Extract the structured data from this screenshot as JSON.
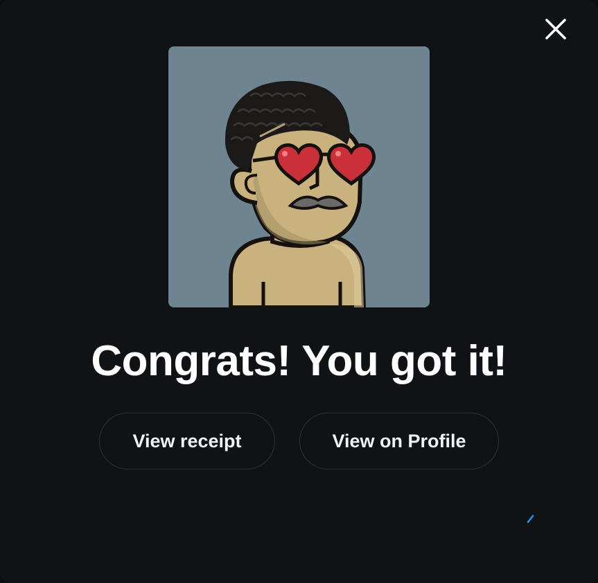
{
  "dialog": {
    "headline": "Congrats! You got it!",
    "close_icon": "close-icon",
    "nft_image": "cartoon-avatar-heart-sunglasses-mustache",
    "buttons": {
      "view_receipt": "View receipt",
      "view_on_profile": "View on Profile"
    }
  },
  "colors": {
    "background": "#111215",
    "button_border": "#2f3237",
    "text": "#ffffff",
    "art_background": "#6e8591",
    "skin": "#c9b27e",
    "heart": "#c9303a"
  }
}
